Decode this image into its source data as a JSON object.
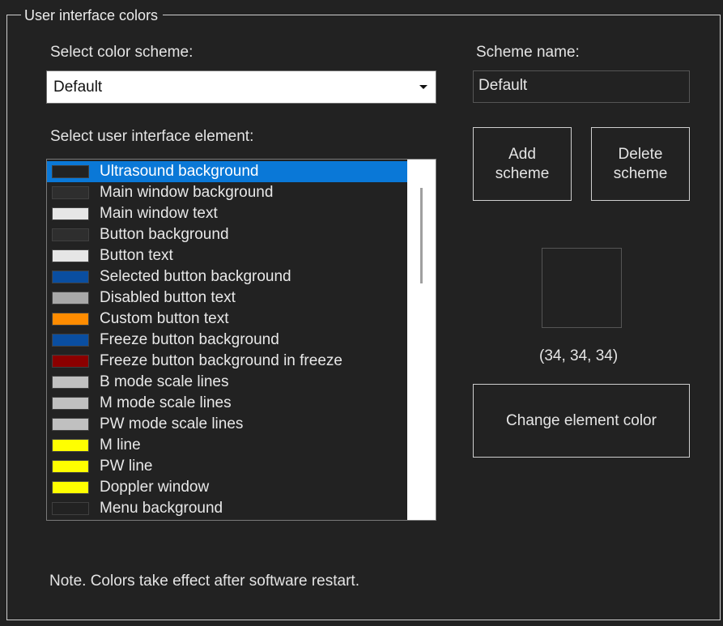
{
  "group_title": "User interface colors",
  "scheme_label": "Select color scheme:",
  "scheme_selected": "Default",
  "scheme_name_label": "Scheme name:",
  "scheme_name_value": "Default",
  "element_label": "Select user interface element:",
  "elements": [
    {
      "label": "Ultrasound background",
      "color": "#222222",
      "selected": true
    },
    {
      "label": "Main window background",
      "color": "#2e2e2e"
    },
    {
      "label": "Main window text",
      "color": "#e6e6e6"
    },
    {
      "label": "Button background",
      "color": "#2e2e2e"
    },
    {
      "label": "Button text",
      "color": "#e6e6e6"
    },
    {
      "label": "Selected button background",
      "color": "#0a4ea0"
    },
    {
      "label": "Disabled button text",
      "color": "#a8a8a8"
    },
    {
      "label": "Custom button text",
      "color": "#ff8c00"
    },
    {
      "label": "Freeze button background",
      "color": "#0a4ea0"
    },
    {
      "label": "Freeze button background in freeze",
      "color": "#8b0000"
    },
    {
      "label": "B mode scale lines",
      "color": "#c0c0c0"
    },
    {
      "label": "M mode scale lines",
      "color": "#c0c0c0"
    },
    {
      "label": "PW mode scale lines",
      "color": "#c0c0c0"
    },
    {
      "label": "M line",
      "color": "#ffff00"
    },
    {
      "label": "PW line",
      "color": "#ffff00"
    },
    {
      "label": "Doppler window",
      "color": "#ffff00"
    },
    {
      "label": "Menu background",
      "color": "#222222"
    }
  ],
  "add_button": "Add\nscheme",
  "delete_button": "Delete\nscheme",
  "preview_color": "#222222",
  "rgb_text": "(34, 34, 34)",
  "change_button": "Change element color",
  "note": "Note. Colors take effect after software restart."
}
